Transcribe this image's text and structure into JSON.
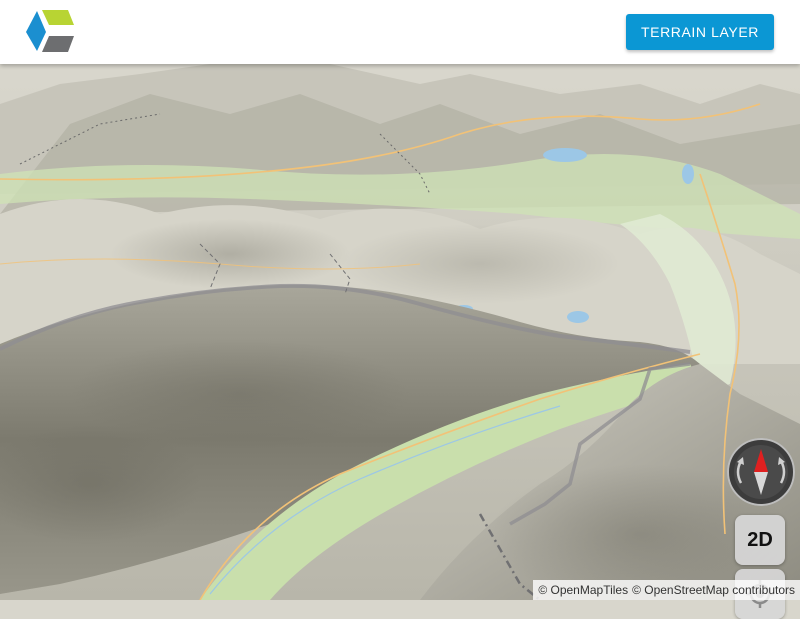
{
  "header": {
    "terrain_button_label": "TERRAIN LAYER"
  },
  "logo": {
    "colors": [
      "#1b8fd0",
      "#b8d433",
      "#6d6e70"
    ]
  },
  "map": {
    "view": "3D terrain",
    "controls": {
      "compass_icon": "compass-north-icon",
      "mode_button_label": "2D",
      "locate_icon": "locate-crosshair-icon"
    },
    "attribution": {
      "part1": "© OpenMapTiles",
      "part2": "© OpenStreetMap contributors"
    }
  },
  "colors": {
    "accent": "#0b97d4",
    "terrain_light": "#e4e2da",
    "terrain_dark": "#6f6d62",
    "valley_green": "#cfe3b5",
    "road": "#f2c277",
    "water": "#9cc7e6"
  }
}
